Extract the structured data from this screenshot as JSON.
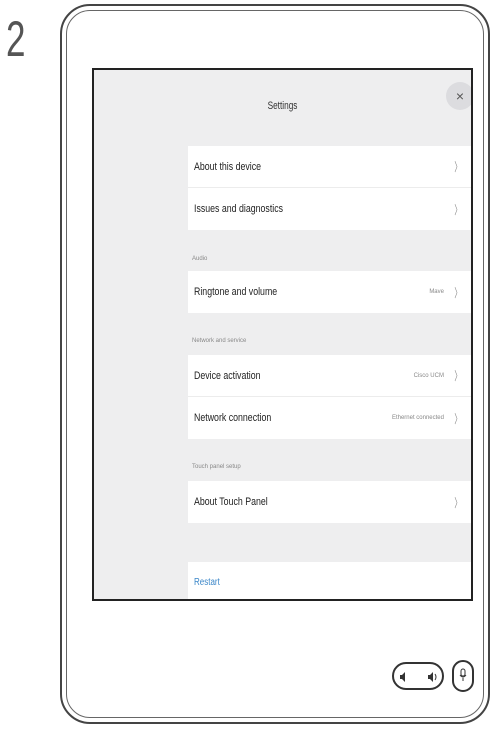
{
  "step_number": "2",
  "screen": {
    "title": "Settings",
    "close_label": "×",
    "groups": [
      {
        "section": "",
        "items": [
          {
            "label": "About this device",
            "value": ""
          },
          {
            "label": "Issues and diagnostics",
            "value": ""
          }
        ]
      },
      {
        "section": "Audio",
        "items": [
          {
            "label": "Ringtone and volume",
            "value": "Mave"
          }
        ]
      },
      {
        "section": "Network and service",
        "items": [
          {
            "label": "Device activation",
            "value": "Cisco UCM"
          },
          {
            "label": "Network connection",
            "value": "Ethernet connected"
          }
        ]
      },
      {
        "section": "Touch panel setup",
        "items": [
          {
            "label": "About Touch Panel",
            "value": ""
          }
        ]
      }
    ],
    "chevron": "〉",
    "restart_label": "Restart"
  },
  "hardware": {
    "volume_down_icon": "speaker-low-icon",
    "volume_up_icon": "speaker-high-icon",
    "mute_icon": "microphone-icon"
  }
}
